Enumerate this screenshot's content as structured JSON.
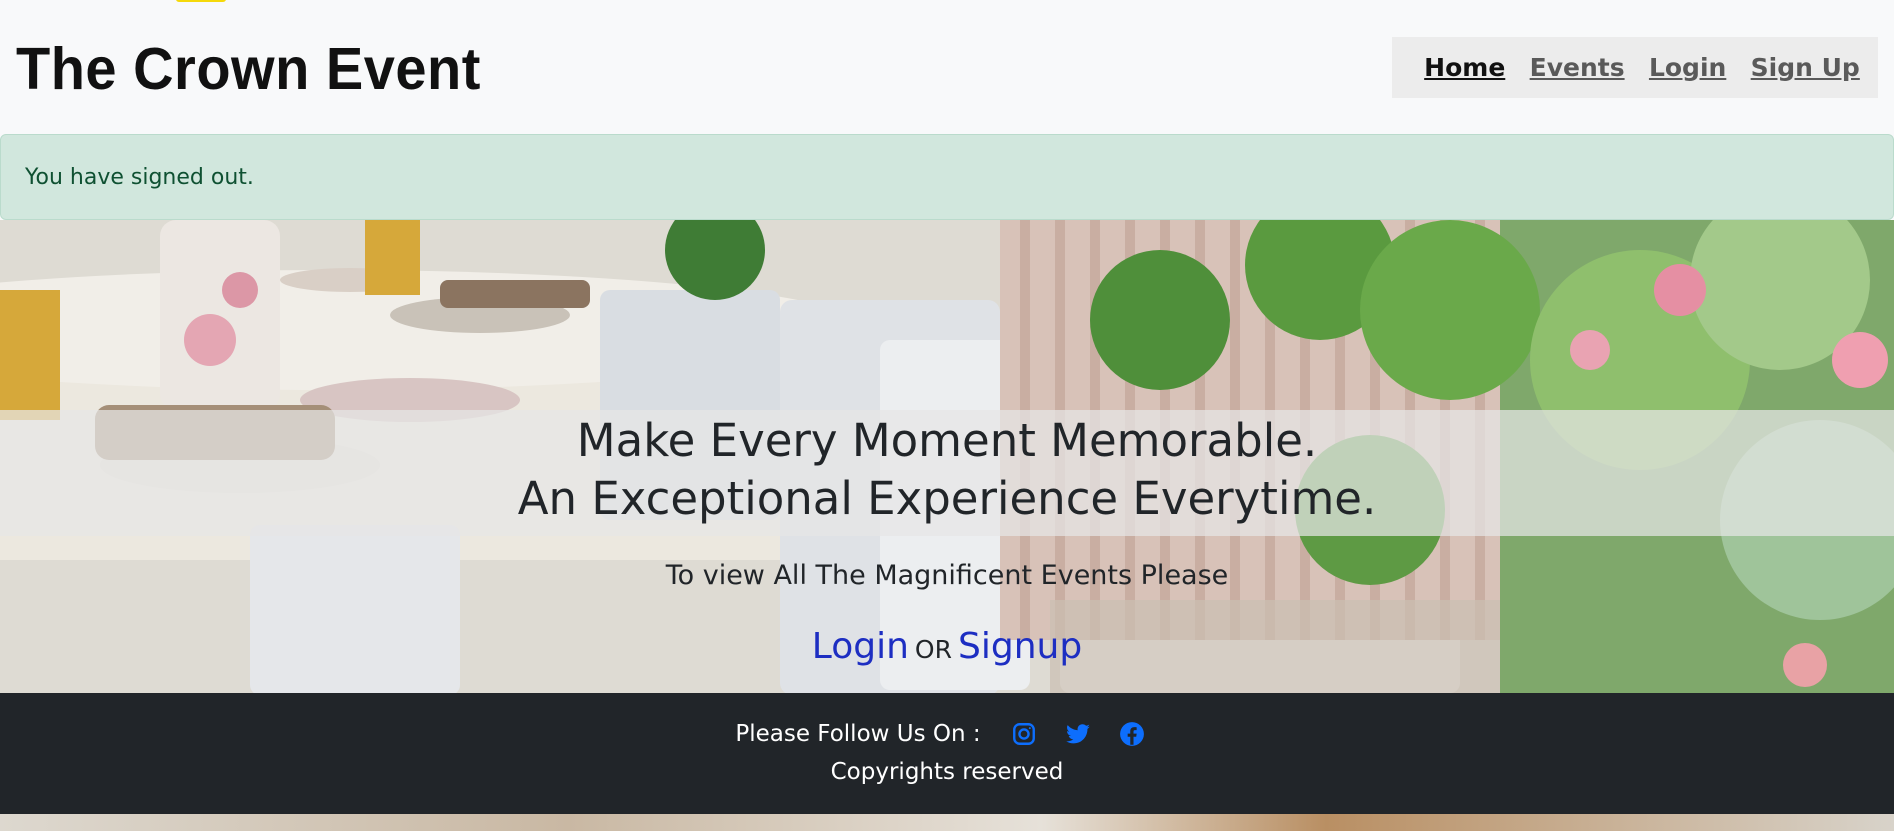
{
  "header": {
    "brand": "The Crown Event",
    "nav": [
      {
        "label": "Home",
        "active": true
      },
      {
        "label": "Events",
        "active": false
      },
      {
        "label": "Login",
        "active": false
      },
      {
        "label": "Sign Up",
        "active": false
      }
    ]
  },
  "alert": {
    "message": "You have signed out."
  },
  "hero": {
    "tagline_line1": "Make Every Moment Memorable.",
    "tagline_line2": "An Exceptional Experience Everytime.",
    "prompt": "To view All The Magnificent Events Please",
    "login_link": "Login",
    "or_text": "OR",
    "signup_link": "Signup",
    "image": "outdoor-wedding-table-setting"
  },
  "footer": {
    "follow_label": "Please Follow Us On :",
    "social_icons": [
      "instagram-icon",
      "twitter-icon",
      "facebook-icon"
    ],
    "icon_color": "#0d6efd",
    "copyright": "Copyrights reserved"
  },
  "colors": {
    "alert_bg": "#d1e7dd",
    "alert_text": "#0f5132",
    "footer_bg": "#212529",
    "link": "#1d2ec2"
  }
}
